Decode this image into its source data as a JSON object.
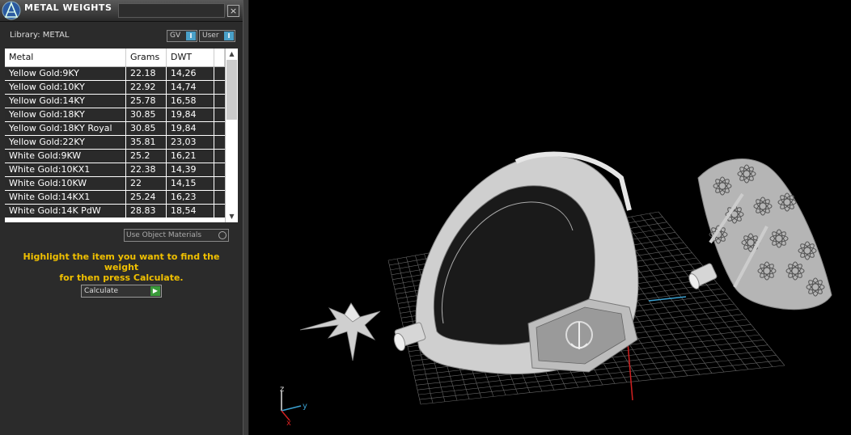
{
  "window": {
    "title": "METAL WEIGHTS",
    "close_glyph": "×"
  },
  "library": {
    "label": "Library: METAL",
    "gv_label": "GV",
    "user_label": "User"
  },
  "table": {
    "headers": [
      "Metal",
      "Grams",
      "DWT"
    ],
    "rows": [
      [
        "Yellow Gold:9KY",
        "22.18",
        "14,26"
      ],
      [
        "Yellow Gold:10KY",
        "22.92",
        "14,74"
      ],
      [
        "Yellow Gold:14KY",
        "25.78",
        "16,58"
      ],
      [
        "Yellow Gold:18KY",
        "30.85",
        "19,84"
      ],
      [
        "Yellow Gold:18KY Royal",
        "30.85",
        "19,84"
      ],
      [
        "Yellow Gold:22KY",
        "35.81",
        "23,03"
      ],
      [
        "White Gold:9KW",
        "25.2",
        "16,21"
      ],
      [
        "White Gold:10KX1",
        "22.38",
        "14,39"
      ],
      [
        "White Gold:10KW",
        "22",
        "14,15"
      ],
      [
        "White Gold:14KX1",
        "25.24",
        "16,23"
      ],
      [
        "White Gold:14K PdW",
        "28.83",
        "18,54"
      ]
    ]
  },
  "options": {
    "use_object_materials": "Use Object Materials"
  },
  "instruction": {
    "line1": "Highlight the item you want to find the weight",
    "line2": "for then press Calculate."
  },
  "calculate": {
    "label": "Calculate"
  },
  "axes": {
    "z": "z",
    "y": "y",
    "x": "x"
  },
  "colors": {
    "instruction": "#f0c000",
    "axis_z": "#e0e0e0",
    "axis_y": "#3aa0d0",
    "axis_x": "#d02020",
    "grid": "#666666",
    "model": "#d8d8d8"
  }
}
